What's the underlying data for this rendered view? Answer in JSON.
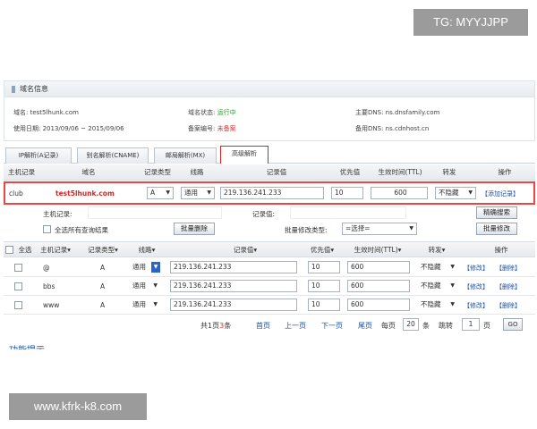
{
  "watermarks": {
    "top": "TG: MYYJJPP",
    "bottom": "www.kfrk-k8.com"
  },
  "panel": {
    "title": "域名信息",
    "domain_label": "域名:",
    "domain_value": "test5lhunk.com",
    "status_label": "域名状态:",
    "status_value": "运行中",
    "dns_main_label": "主要DNS:",
    "dns_main_value": "ns.dnsfamily.com",
    "date_label": "使用日期:",
    "date_value": "2013/09/06 ~ 2015/09/06",
    "record_label": "备案编号:",
    "record_value": "未备案",
    "dns_backup_label": "备用DNS:",
    "dns_backup_value": "ns.cdnhost.cn"
  },
  "tabs": [
    "IP解析(A记录)",
    "别名解析(CNAME)",
    "邮局解析(MX)",
    "高级解析"
  ],
  "grid_headers": [
    "主机记录",
    "域名",
    "记录类型",
    "线路",
    "记录值",
    "优先值",
    "生效时间(TTL)",
    "转发",
    "操作"
  ],
  "add_row": {
    "host": "club",
    "domain": "test5lhunk.com",
    "type": "A",
    "line": "通用",
    "value": "219.136.241.233",
    "priority": "10",
    "ttl": "600",
    "forward": "不隐藏",
    "action": "【添加记录】"
  },
  "search": {
    "host_label": "主机记录:",
    "value_label": "记录值:",
    "button": "精确搜索"
  },
  "batch": {
    "select_all_label": "全选所有查询结果",
    "delete_button": "批量删除",
    "modify_type_label": "批量修改类型:",
    "modify_select": "=选择=",
    "modify_button": "批量修改"
  },
  "list_headers": [
    "全选",
    "主机记录▾",
    "记录类型▾",
    "线路▾",
    "记录值▾",
    "优先值▾",
    "生效时间(TTL)▾",
    "转发▾",
    "操作"
  ],
  "records": [
    {
      "host": "@",
      "type": "A",
      "line": "通用",
      "value": "219.136.241.233",
      "priority": "10",
      "ttl": "600",
      "forward": "不隐藏",
      "edit": "【修改】",
      "delete": "【删除】"
    },
    {
      "host": "bbs",
      "type": "A",
      "line": "通用",
      "value": "219.136.241.233",
      "priority": "10",
      "ttl": "600",
      "forward": "不隐藏",
      "edit": "【修改】",
      "delete": "【删除】"
    },
    {
      "host": "www",
      "type": "A",
      "line": "通用",
      "value": "219.136.241.233",
      "priority": "10",
      "ttl": "600",
      "forward": "不隐藏",
      "edit": "【修改】",
      "delete": "【删除】"
    }
  ],
  "pager": {
    "total_prefix": "共1页",
    "total_count": "3",
    "total_suffix": "条",
    "first": "首页",
    "prev": "上一页",
    "next": "下一页",
    "last": "尾页",
    "per_page_label": "每页",
    "per_page": "20",
    "per_page_unit": "条",
    "jump_label": "跳转",
    "page": "1",
    "page_unit": "页",
    "go": "GO"
  },
  "bottom_link": "功能提示"
}
